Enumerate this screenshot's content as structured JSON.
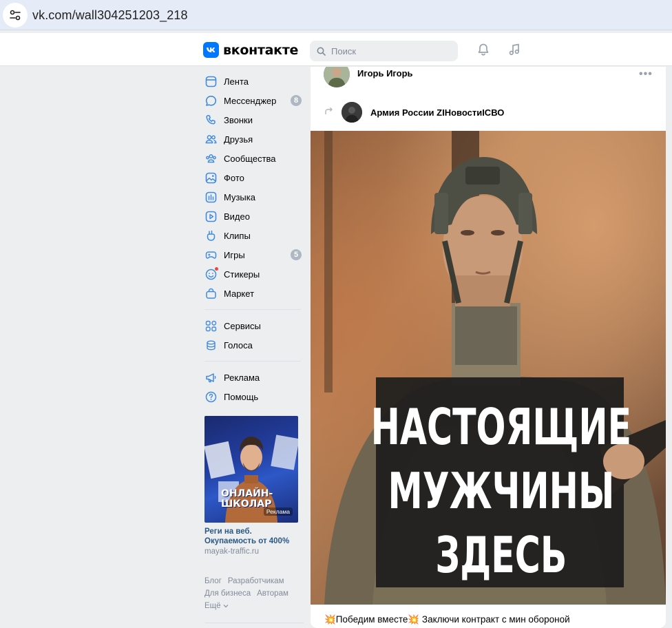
{
  "browser": {
    "url": "vk.com/wall304251203_218"
  },
  "header": {
    "logo_letter": "VK",
    "logo_text": "вконтакте",
    "search_placeholder": "Поиск"
  },
  "sidebar": {
    "items": [
      {
        "label": "Лента",
        "icon": "newsfeed-icon"
      },
      {
        "label": "Мессенджер",
        "icon": "message-icon",
        "badge": "8"
      },
      {
        "label": "Звонки",
        "icon": "phone-icon"
      },
      {
        "label": "Друзья",
        "icon": "friends-icon"
      },
      {
        "label": "Сообщества",
        "icon": "communities-icon"
      },
      {
        "label": "Фото",
        "icon": "photo-icon"
      },
      {
        "label": "Музыка",
        "icon": "music-icon"
      },
      {
        "label": "Видео",
        "icon": "video-icon"
      },
      {
        "label": "Клипы",
        "icon": "clips-icon"
      },
      {
        "label": "Игры",
        "icon": "games-icon",
        "badge": "5"
      },
      {
        "label": "Стикеры",
        "icon": "stickers-icon"
      },
      {
        "label": "Маркет",
        "icon": "market-icon"
      }
    ],
    "items2": [
      {
        "label": "Сервисы",
        "icon": "services-icon"
      },
      {
        "label": "Голоса",
        "icon": "votes-icon"
      }
    ],
    "items3": [
      {
        "label": "Реклама",
        "icon": "megaphone-icon"
      },
      {
        "label": "Помощь",
        "icon": "help-icon"
      }
    ],
    "ad": {
      "image_text_line1": "ОНЛАЙН-",
      "image_text_line2": "ШКОЛАР",
      "image_badge": "Реклама",
      "title": "Реги на веб. Окупаемость от 400%",
      "url": "mayak-traffic.ru"
    },
    "footer": [
      "Блог",
      "Разработчикам",
      "Для бизнеса",
      "Авторам",
      "Ещё"
    ]
  },
  "post": {
    "author": "Игорь Игорь",
    "repost_from": "Армия России ZIНовостиIСВО",
    "photo_text": [
      "НАСТОЯЩИЕ",
      "МУЖЧИНЫ",
      "ЗДЕСЬ"
    ],
    "text": "💥Победим вместе💥 Заключи контракт с мин обороной"
  },
  "colors": {
    "accent": "#0077ff",
    "link": "#2a5885",
    "badge": "#aeb7c2"
  }
}
